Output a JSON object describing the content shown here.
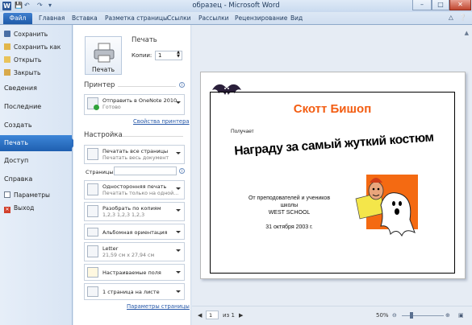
{
  "window": {
    "title": "образец - Microsoft Word",
    "app_icon": "W",
    "controls": [
      "–",
      "□",
      "✕"
    ]
  },
  "ribbon": {
    "file_tab": "Файл",
    "tabs": [
      "Главная",
      "Вставка",
      "Разметка страницы",
      "Ссылки",
      "Рассылки",
      "Рецензирование",
      "Вид"
    ]
  },
  "nav": {
    "save": "Сохранить",
    "save_as": "Сохранить как",
    "open": "Открыть",
    "close": "Закрыть",
    "info": "Сведения",
    "recent": "Последние",
    "new": "Создать",
    "print": "Печать",
    "share": "Доступ",
    "help": "Справка",
    "options": "Параметры",
    "exit": "Выход"
  },
  "print": {
    "heading": "Печать",
    "button_label": "Печать",
    "copies_label": "Копии:",
    "copies_value": "1"
  },
  "printer": {
    "heading": "Принтер",
    "name": "Отправить в OneNote 2010",
    "status": "Готово",
    "properties_link": "Свойства принтера"
  },
  "settings": {
    "heading": "Настройка",
    "pages_label": "Страницы:",
    "page_setup_link": "Параметры страницы",
    "options": [
      {
        "line1": "Печатать все страницы",
        "line2": "Печатать весь документ"
      },
      {
        "line1": "Односторонняя печать",
        "line2": "Печатать только на одной..."
      },
      {
        "line1": "Разобрать по копиям",
        "line2": "1,2,3    1,2,3    1,2,3"
      },
      {
        "line1": "Альбомная ориентация",
        "line2": ""
      },
      {
        "line1": "Letter",
        "line2": "21,59 см x 27,94 см"
      },
      {
        "line1": "Настраиваемые поля",
        "line2": ""
      },
      {
        "line1": "1 страница на листе",
        "line2": ""
      }
    ]
  },
  "document": {
    "name": "Скотт Бишоп",
    "receives": "Получает",
    "award": "Награду за самый жуткий костюм",
    "from_line1": "От преподователей  и учеников",
    "from_line2": "школы",
    "school": "WEST SCHOOL",
    "date": "31 октября 2003 г."
  },
  "status": {
    "page_current": "1",
    "page_of": "из 1",
    "zoom": "50%"
  },
  "colors": {
    "accent": "#1f5fb0",
    "name_orange": "#f35d12"
  }
}
